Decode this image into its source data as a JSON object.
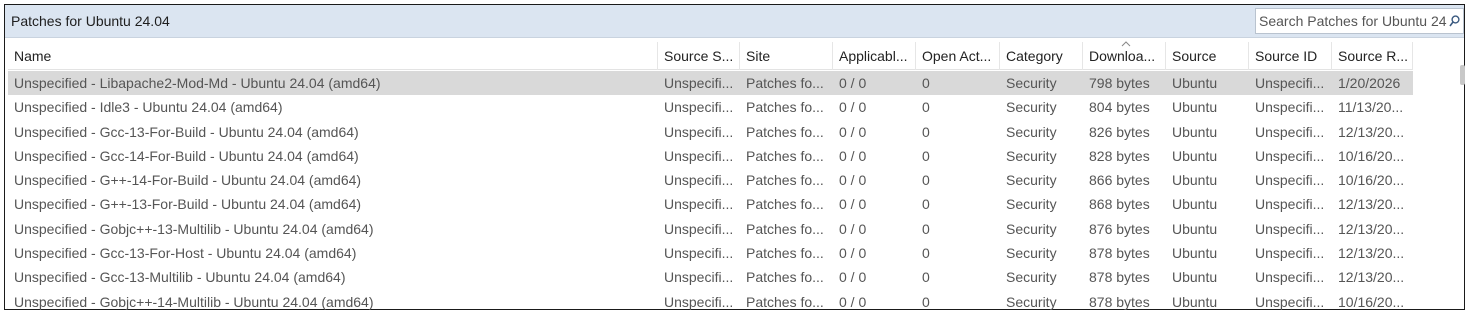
{
  "panel": {
    "title": "Patches for Ubuntu 24.04",
    "search_placeholder": "Search Patches for Ubuntu 24.04"
  },
  "columns": [
    {
      "key": "name",
      "label": "Name"
    },
    {
      "key": "source_status",
      "label": "Source S..."
    },
    {
      "key": "site",
      "label": "Site"
    },
    {
      "key": "applicable",
      "label": "Applicabl..."
    },
    {
      "key": "open_actions",
      "label": "Open Act..."
    },
    {
      "key": "category",
      "label": "Category"
    },
    {
      "key": "download",
      "label": "Downloa..."
    },
    {
      "key": "source",
      "label": "Source"
    },
    {
      "key": "source_id",
      "label": "Source ID"
    },
    {
      "key": "source_release",
      "label": "Source R..."
    }
  ],
  "rows": [
    {
      "name": "Unspecified - Libapache2-Mod-Md - Ubuntu 24.04 (amd64)",
      "source_status": "Unspecifi...",
      "site": "Patches fo...",
      "applicable": "0 / 0",
      "open_actions": "0",
      "category": "Security",
      "download": "798 bytes",
      "source": "Ubuntu",
      "source_id": "Unspecifi...",
      "source_release": "1/20/2026",
      "selected": true
    },
    {
      "name": "Unspecified - Idle3 - Ubuntu 24.04 (amd64)",
      "source_status": "Unspecifi...",
      "site": "Patches fo...",
      "applicable": "0 / 0",
      "open_actions": "0",
      "category": "Security",
      "download": "804 bytes",
      "source": "Ubuntu",
      "source_id": "Unspecifi...",
      "source_release": "11/13/20..."
    },
    {
      "name": "Unspecified - Gcc-13-For-Build - Ubuntu 24.04 (amd64)",
      "source_status": "Unspecifi...",
      "site": "Patches fo...",
      "applicable": "0 / 0",
      "open_actions": "0",
      "category": "Security",
      "download": "826 bytes",
      "source": "Ubuntu",
      "source_id": "Unspecifi...",
      "source_release": "12/13/20..."
    },
    {
      "name": "Unspecified - Gcc-14-For-Build - Ubuntu 24.04 (amd64)",
      "source_status": "Unspecifi...",
      "site": "Patches fo...",
      "applicable": "0 / 0",
      "open_actions": "0",
      "category": "Security",
      "download": "828 bytes",
      "source": "Ubuntu",
      "source_id": "Unspecifi...",
      "source_release": "10/16/20..."
    },
    {
      "name": "Unspecified - G++-14-For-Build - Ubuntu 24.04 (amd64)",
      "source_status": "Unspecifi...",
      "site": "Patches fo...",
      "applicable": "0 / 0",
      "open_actions": "0",
      "category": "Security",
      "download": "866 bytes",
      "source": "Ubuntu",
      "source_id": "Unspecifi...",
      "source_release": "10/16/20..."
    },
    {
      "name": "Unspecified - G++-13-For-Build - Ubuntu 24.04 (amd64)",
      "source_status": "Unspecifi...",
      "site": "Patches fo...",
      "applicable": "0 / 0",
      "open_actions": "0",
      "category": "Security",
      "download": "868 bytes",
      "source": "Ubuntu",
      "source_id": "Unspecifi...",
      "source_release": "12/13/20..."
    },
    {
      "name": "Unspecified - Gobjc++-13-Multilib - Ubuntu 24.04 (amd64)",
      "source_status": "Unspecifi...",
      "site": "Patches fo...",
      "applicable": "0 / 0",
      "open_actions": "0",
      "category": "Security",
      "download": "876 bytes",
      "source": "Ubuntu",
      "source_id": "Unspecifi...",
      "source_release": "12/13/20..."
    },
    {
      "name": "Unspecified - Gcc-13-For-Host - Ubuntu 24.04 (amd64)",
      "source_status": "Unspecifi...",
      "site": "Patches fo...",
      "applicable": "0 / 0",
      "open_actions": "0",
      "category": "Security",
      "download": "878 bytes",
      "source": "Ubuntu",
      "source_id": "Unspecifi...",
      "source_release": "12/13/20..."
    },
    {
      "name": "Unspecified - Gcc-13-Multilib - Ubuntu 24.04 (amd64)",
      "source_status": "Unspecifi...",
      "site": "Patches fo...",
      "applicable": "0 / 0",
      "open_actions": "0",
      "category": "Security",
      "download": "878 bytes",
      "source": "Ubuntu",
      "source_id": "Unspecifi...",
      "source_release": "12/13/20..."
    },
    {
      "name": "Unspecified - Gobjc++-14-Multilib - Ubuntu 24.04 (amd64)",
      "source_status": "Unspecifi...",
      "site": "Patches fo...",
      "applicable": "0 / 0",
      "open_actions": "0",
      "category": "Security",
      "download": "878 bytes",
      "source": "Ubuntu",
      "source_id": "Unspecifi...",
      "source_release": "10/16/20..."
    }
  ],
  "sort": {
    "column": "download",
    "direction": "ascending"
  },
  "icons": {
    "search": "search-icon",
    "sort": "sort-ascending-icon"
  },
  "colors": {
    "title_bar": "#dbe5f1",
    "selected_row": "#d9d9d9"
  }
}
